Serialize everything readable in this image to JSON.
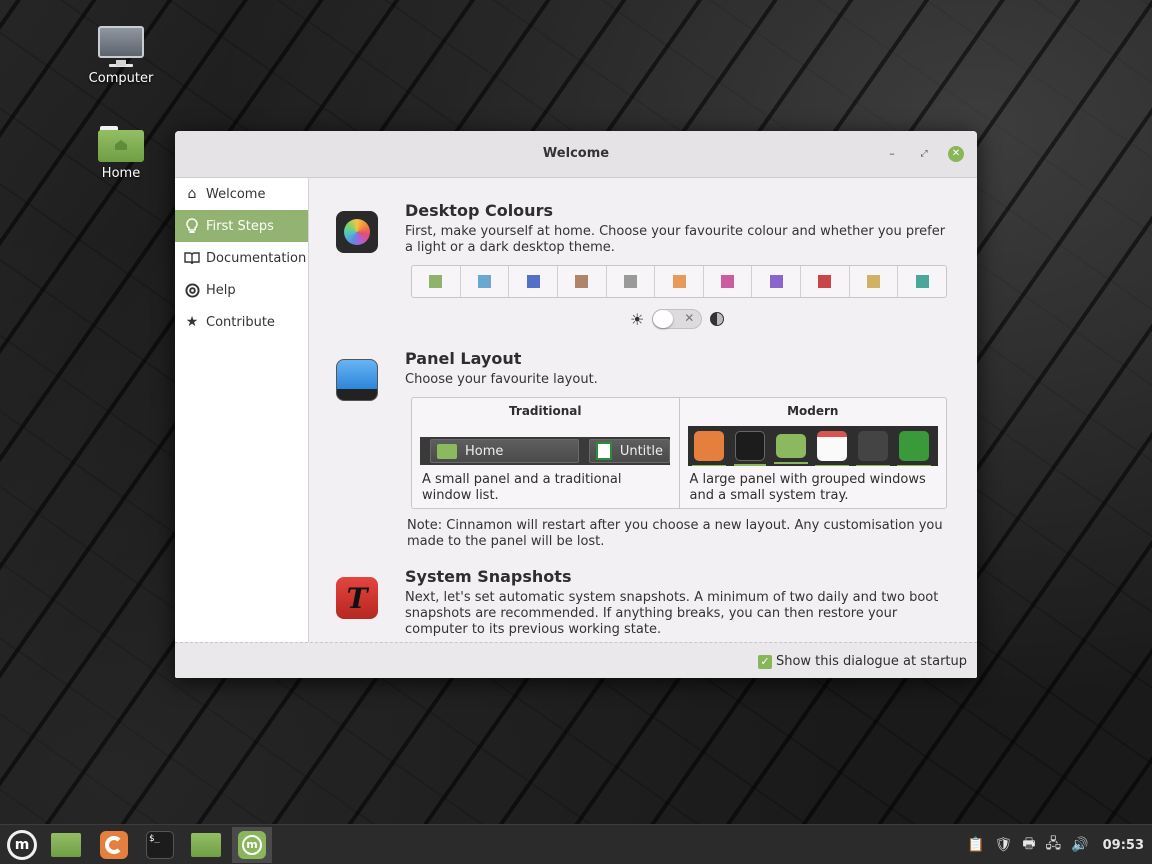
{
  "desktop": {
    "icons": [
      {
        "label": "Computer"
      },
      {
        "label": "Home"
      }
    ]
  },
  "window": {
    "title": "Welcome",
    "controls": {
      "minimize": "–",
      "maximize": "⤢",
      "close": "✕"
    }
  },
  "sidebar": {
    "items": [
      {
        "label": "Welcome",
        "icon": "home-icon",
        "glyph": "⌂"
      },
      {
        "label": "First Steps",
        "icon": "lightbulb-icon",
        "glyph": "💡"
      },
      {
        "label": "Documentation",
        "icon": "book-icon",
        "glyph": "📖"
      },
      {
        "label": "Help",
        "icon": "lifebuoy-icon",
        "glyph": "⛑"
      },
      {
        "label": "Contribute",
        "icon": "star-icon",
        "glyph": "★"
      }
    ],
    "active": "First Steps"
  },
  "sections": {
    "colours": {
      "title": "Desktop Colours",
      "text": "First, make yourself at home. Choose your favourite colour and whether you prefer a light or a dark desktop theme.",
      "swatches": [
        "#8fb36b",
        "#6aa8d0",
        "#5470c6",
        "#b08468",
        "#9a9a9a",
        "#e59a5a",
        "#cc5c9e",
        "#8a65cc",
        "#c9454a",
        "#d0b265",
        "#4aa79a"
      ],
      "dark_mode": false
    },
    "panel": {
      "title": "Panel Layout",
      "text": "Choose your favourite layout.",
      "options": [
        {
          "title": "Traditional",
          "desc": "A small panel and a traditional window list.",
          "preview_labels": [
            "Home",
            "Untitle"
          ]
        },
        {
          "title": "Modern",
          "desc": "A large panel with grouped windows and a small system tray."
        }
      ],
      "note": "Note: Cinnamon will restart after you choose a new layout. Any customisation you made to the panel will be lost."
    },
    "snapshots": {
      "title": "System Snapshots",
      "text": "Next, let's set automatic system snapshots. A minimum of two daily and two boot snapshots are recommended. If anything breaks, you can then restore your computer to its previous working state."
    }
  },
  "footer": {
    "startup_label": "Show this dialogue at startup",
    "startup_checked": true
  },
  "taskbar": {
    "apps": [
      "menu",
      "files",
      "firefox",
      "terminal",
      "files",
      "welcome"
    ],
    "terminal_prompt": "$_",
    "clock": "09:53"
  }
}
